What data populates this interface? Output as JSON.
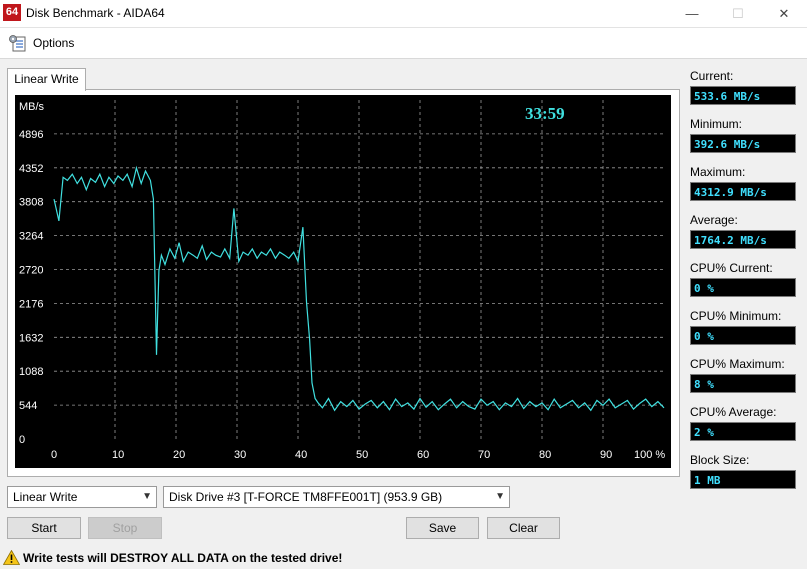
{
  "window": {
    "app_icon": "64",
    "title": "Disk Benchmark - AIDA64",
    "minimize_icon": "—",
    "maximize_icon": "☐",
    "close_icon": "✕"
  },
  "menu": {
    "options_label": "Options"
  },
  "tab": {
    "label": "Linear Write"
  },
  "chart": {
    "timer": "33:59"
  },
  "chart_data": {
    "type": "line",
    "title": "",
    "ylabel": "MB/s",
    "xlabel": "",
    "y_ticks": [
      "4896",
      "4352",
      "3808",
      "3264",
      "2720",
      "2176",
      "1632",
      "1088",
      "544",
      "0"
    ],
    "x_ticks": [
      "0",
      "10",
      "20",
      "30",
      "40",
      "50",
      "60",
      "70",
      "80",
      "90",
      "100 %"
    ],
    "xlim": [
      0,
      100
    ],
    "ylim": [
      0,
      5440
    ],
    "grid": true,
    "colors": {
      "line": "#40e0e0",
      "grid": "#9a9a9a",
      "background": "#000000",
      "timer": "#40e0e0"
    },
    "series": [
      {
        "values_x": [
          0,
          0.8,
          1.5,
          2.2,
          3,
          3.8,
          4.5,
          5.3,
          6,
          6.8,
          7.5,
          8.3,
          9,
          9.8,
          10.5,
          11.3,
          12,
          12.8,
          13.5,
          14.3,
          15,
          15.8,
          16.3,
          16.8,
          17.2,
          17.6,
          18.2,
          19,
          19.8,
          20.5,
          21.2,
          22,
          22.8,
          23.5,
          24.3,
          25,
          25.8,
          26.5,
          27.3,
          28,
          28.8,
          29.5,
          30.3,
          31,
          31.8,
          32.5,
          33.3,
          34,
          34.8,
          35.5,
          36.3,
          37,
          37.8,
          38.5,
          39.3,
          40,
          40.8,
          41.4,
          41.9,
          42.3,
          42.8,
          43.3,
          44,
          45,
          46,
          47,
          48,
          49,
          50,
          51,
          52,
          53,
          54,
          55,
          56,
          57,
          58,
          59,
          60,
          61,
          62,
          63,
          64,
          65,
          66,
          67,
          68,
          69,
          70,
          71,
          72,
          73,
          74,
          75,
          76,
          77,
          78,
          79,
          80,
          81,
          82,
          83,
          84,
          85,
          86,
          87,
          88,
          89,
          90,
          91,
          92,
          93,
          94,
          95,
          96,
          97,
          98,
          99,
          100
        ],
        "values_y": [
          3850,
          3500,
          4200,
          4150,
          4250,
          4100,
          4200,
          4000,
          4180,
          4120,
          4250,
          4050,
          4200,
          4100,
          4220,
          4150,
          4250,
          4050,
          4350,
          4100,
          4300,
          4150,
          3850,
          1350,
          2700,
          2950,
          2800,
          3050,
          2900,
          3150,
          2850,
          3000,
          2950,
          2900,
          3100,
          2880,
          3000,
          2950,
          2920,
          3050,
          2900,
          3700,
          2850,
          3000,
          2950,
          3050,
          2900,
          3000,
          2950,
          3050,
          2900,
          3000,
          2950,
          2900,
          3000,
          2850,
          3400,
          2200,
          1600,
          900,
          650,
          580,
          500,
          650,
          460,
          600,
          520,
          620,
          480,
          560,
          620,
          500,
          600,
          470,
          640,
          520,
          580,
          480,
          650,
          510,
          600,
          470,
          560,
          640,
          500,
          600,
          520,
          480,
          640,
          540,
          600,
          470,
          580,
          520,
          650,
          490,
          600,
          520,
          580,
          470,
          640,
          500,
          560,
          620,
          500,
          580,
          460,
          620,
          540,
          640,
          500,
          560,
          620,
          480,
          570,
          640,
          520,
          600,
          500,
          1000,
          540
        ]
      }
    ]
  },
  "stats": [
    {
      "label": "Current:",
      "value": "533.6 MB/s"
    },
    {
      "label": "Minimum:",
      "value": "392.6 MB/s"
    },
    {
      "label": "Maximum:",
      "value": "4312.9 MB/s"
    },
    {
      "label": "Average:",
      "value": "1764.2 MB/s"
    },
    {
      "label": "CPU% Current:",
      "value": "0 %"
    },
    {
      "label": "CPU% Minimum:",
      "value": "0 %"
    },
    {
      "label": "CPU% Maximum:",
      "value": "8 %"
    },
    {
      "label": "CPU% Average:",
      "value": "2 %"
    },
    {
      "label": "Block Size:",
      "value": "1 MB"
    }
  ],
  "controls": {
    "test_select": "Linear Write",
    "drive_select": "Disk Drive #3  [T-FORCE TM8FFE001T]  (953.9 GB)",
    "start": "Start",
    "stop": "Stop",
    "save": "Save",
    "clear": "Clear"
  },
  "warning": {
    "text": "Write tests will DESTROY ALL DATA on the tested drive!"
  }
}
